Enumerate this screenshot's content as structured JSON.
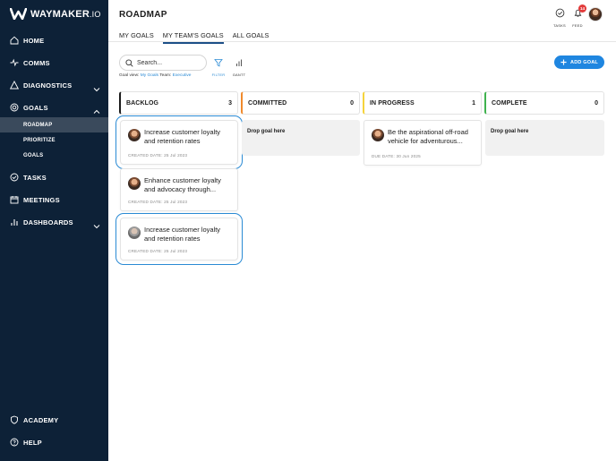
{
  "brand": {
    "name": "WAYMAKER",
    "suffix": ".IO"
  },
  "sidebar": {
    "items": [
      {
        "label": "HOME",
        "icon": "home-icon"
      },
      {
        "label": "COMMS",
        "icon": "pulse-icon"
      },
      {
        "label": "DIAGNOSTICS",
        "icon": "warning-icon"
      },
      {
        "label": "GOALS",
        "icon": "target-icon"
      },
      {
        "label": "TASKS",
        "icon": "check-circle-icon"
      },
      {
        "label": "MEETINGS",
        "icon": "calendar-icon"
      },
      {
        "label": "DASHBOARDS",
        "icon": "bar-chart-icon"
      }
    ],
    "sub_items": [
      {
        "label": "ROADMAP",
        "active": true
      },
      {
        "label": "PRIORITIZE",
        "active": false
      },
      {
        "label": "GOALS",
        "active": false
      }
    ],
    "bottom_items": [
      {
        "label": "ACADEMY",
        "icon": "shield-icon"
      },
      {
        "label": "HELP",
        "icon": "help-icon"
      }
    ]
  },
  "header": {
    "title": "ROADMAP",
    "tasks_label": "TASKS",
    "feed_label": "FEED",
    "feed_badge": "14"
  },
  "tabs": [
    {
      "label": "MY GOALS",
      "active": false
    },
    {
      "label": "MY TEAM'S GOALS",
      "active": true
    },
    {
      "label": "ALL GOALS",
      "active": false
    }
  ],
  "toolbar": {
    "search_placeholder": "Search...",
    "goal_view_prefix": "Goal view:",
    "goal_view_value": "My Goals",
    "team_prefix": "Team:",
    "team_value": "Executive",
    "filter_label": "FILTER",
    "gantt_label": "GANTT",
    "add_goal_label": "ADD GOAL"
  },
  "columns": [
    {
      "title": "BACKLOG",
      "count": "3",
      "color": "#1c1c1c"
    },
    {
      "title": "COMMITTED",
      "count": "0",
      "color": "#f08a2c"
    },
    {
      "title": "IN PROGRESS",
      "count": "1",
      "color": "#f5d33b"
    },
    {
      "title": "COMPLETE",
      "count": "0",
      "color": "#3fb24e"
    }
  ],
  "cards": {
    "backlog": [
      {
        "title": "Increase customer loyalty and retention rates",
        "meta": "CREATED DATE: 25 Jul 2023",
        "highlighted": true
      },
      {
        "title": "Enhance customer loyalty and advocacy through...",
        "meta": "CREATED DATE: 25 Jul 2023",
        "highlighted": false
      },
      {
        "title": "Increase customer loyalty and retention rates",
        "meta": "CREATED DATE: 25 Jul 2023",
        "highlighted": true
      }
    ],
    "in_progress": [
      {
        "title": "Be the aspirational off-road vehicle for adventurous...",
        "meta": "DUE DATE: 30 Jun 2025"
      }
    ]
  },
  "drop_label": "Drop goal here",
  "colors": {
    "sidebar_bg": "#0d2137",
    "accent": "#1f86e0",
    "highlight": "#2a8ad4"
  }
}
